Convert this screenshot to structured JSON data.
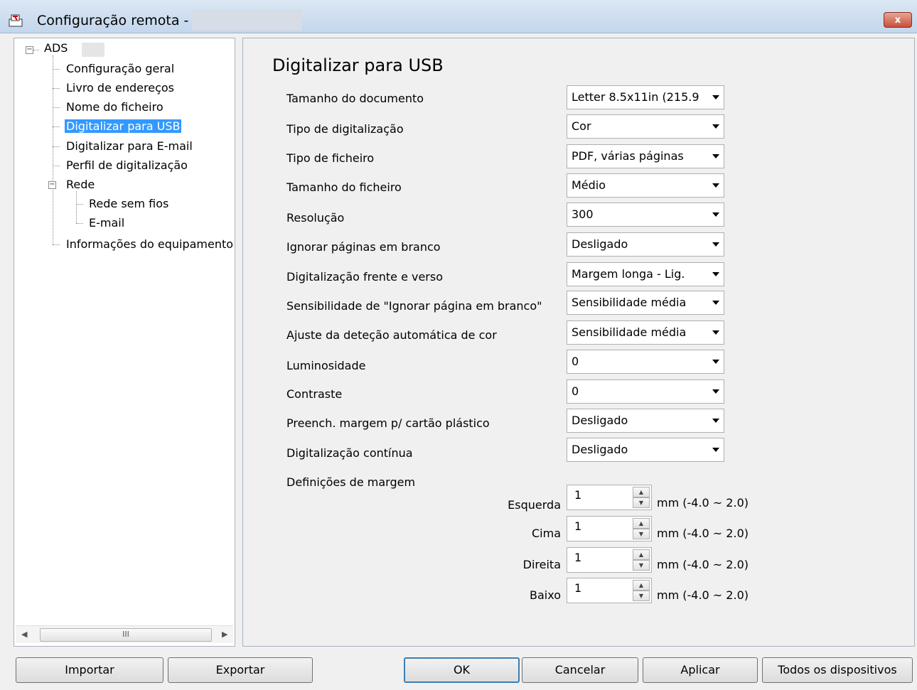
{
  "window": {
    "title": "Configuração remota -",
    "close_label": "x"
  },
  "tree": {
    "root": "ADS",
    "items": [
      "Configuração geral",
      "Livro de endereços",
      "Nome do ficheiro",
      "Digitalizar para USB",
      "Digitalizar para E-mail",
      "Perfil de digitalização",
      "Rede",
      "Rede sem fios",
      "E-mail",
      "Informações do equipamento"
    ],
    "selected": "Digitalizar para USB",
    "scroll_thumb_glyph": "III"
  },
  "panel": {
    "title": "Digitalizar para USB",
    "settings": [
      {
        "label": "Tamanho do documento",
        "value": "Letter 8.5x11in (215.9"
      },
      {
        "label": "Tipo de digitalização",
        "value": "Cor"
      },
      {
        "label": "Tipo de ficheiro",
        "value": "PDF, várias páginas"
      },
      {
        "label": "Tamanho do ficheiro",
        "value": "Médio"
      },
      {
        "label": "Resolução",
        "value": "300"
      },
      {
        "label": "Ignorar páginas em branco",
        "value": "Desligado"
      },
      {
        "label": "Digitalização frente e verso",
        "value": "Margem longa - Lig."
      },
      {
        "label": "Sensibilidade de \"Ignorar página em branco\"",
        "value": "Sensibilidade média"
      },
      {
        "label": "Ajuste da deteção automática de cor",
        "value": "Sensibilidade média"
      },
      {
        "label": "Luminosidade",
        "value": "0"
      },
      {
        "label": "Contraste",
        "value": "0"
      },
      {
        "label": "Preench. margem p/ cartão plástico",
        "value": "Desligado"
      },
      {
        "label": "Digitalização contínua",
        "value": "Desligado"
      }
    ],
    "margins_label": "Definições de margem",
    "margins": [
      {
        "label": "Esquerda",
        "value": "1",
        "range": "mm (-4.0 ~ 2.0)"
      },
      {
        "label": "Cima",
        "value": "1",
        "range": "mm (-4.0 ~ 2.0)"
      },
      {
        "label": "Direita",
        "value": "1",
        "range": "mm (-4.0 ~ 2.0)"
      },
      {
        "label": "Baixo",
        "value": "1",
        "range": "mm (-4.0 ~ 2.0)"
      }
    ]
  },
  "buttons": {
    "import": "Importar",
    "export": "Exportar",
    "ok": "OK",
    "cancel": "Cancelar",
    "apply": "Aplicar",
    "all_devices": "Todos os dispositivos"
  }
}
